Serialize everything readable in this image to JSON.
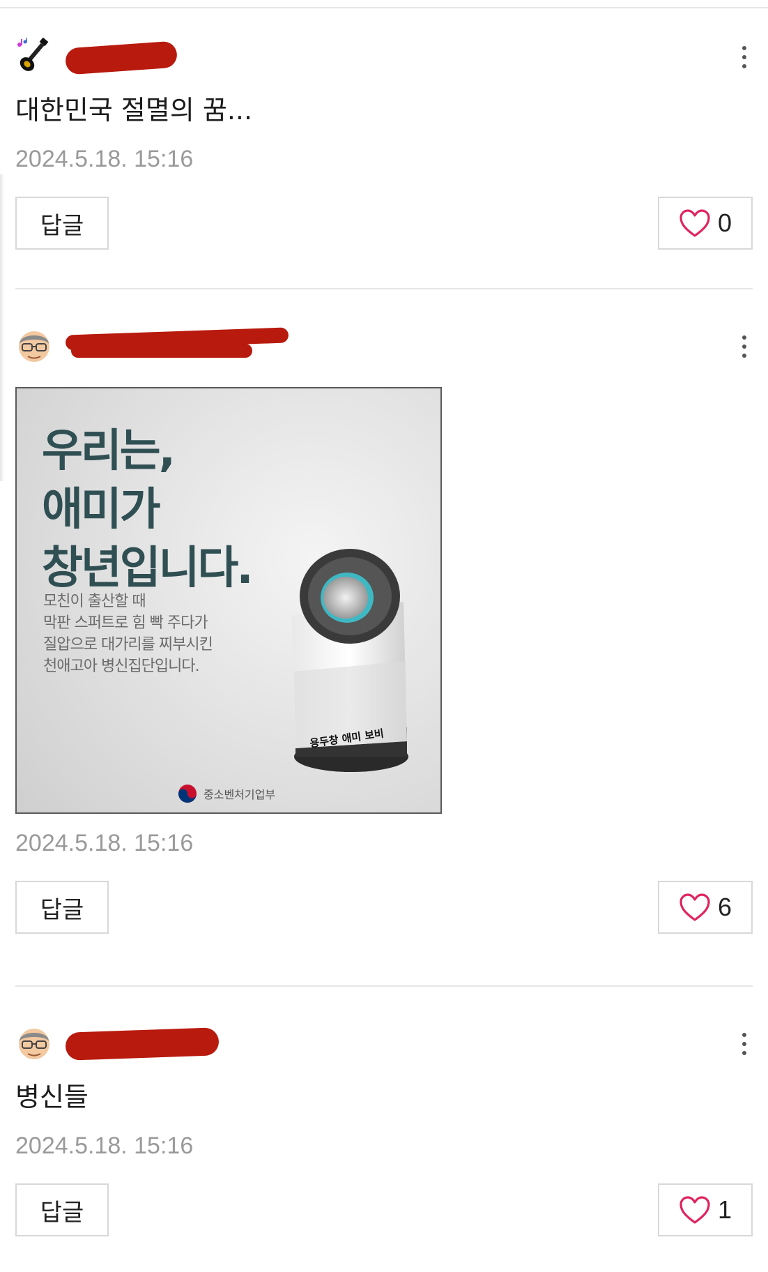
{
  "comments": [
    {
      "body": "대한민국 절멸의 꿈...",
      "timestamp": "2024.5.18. 15:16",
      "reply_label": "답글",
      "likes": "0",
      "avatar_icon": "guitar-icon"
    },
    {
      "timestamp": "2024.5.18. 15:16",
      "reply_label": "답글",
      "likes": "6",
      "avatar_icon": "grandpa-face-icon",
      "image": {
        "headline": [
          "우리는,",
          "애미가",
          "창년입니다."
        ],
        "body_lines": [
          "모친이 출산할 때",
          "막판 스퍼트로 힘 빡 주다가",
          "질압으로 대가리를 찌부시킨",
          "천애고아 병신집단입니다."
        ],
        "product_label": "용두창 애미 보비",
        "logo_text": "중소벤처기업부"
      }
    },
    {
      "body": "병신들",
      "timestamp": "2024.5.18. 15:16",
      "reply_label": "답글",
      "likes": "1",
      "avatar_icon": "grandpa-face-icon"
    }
  ],
  "colors": {
    "heart": "#e0245e",
    "redaction": "#b81a0e",
    "timestamp": "#9a9a9a",
    "headline": "#2f4f53"
  }
}
